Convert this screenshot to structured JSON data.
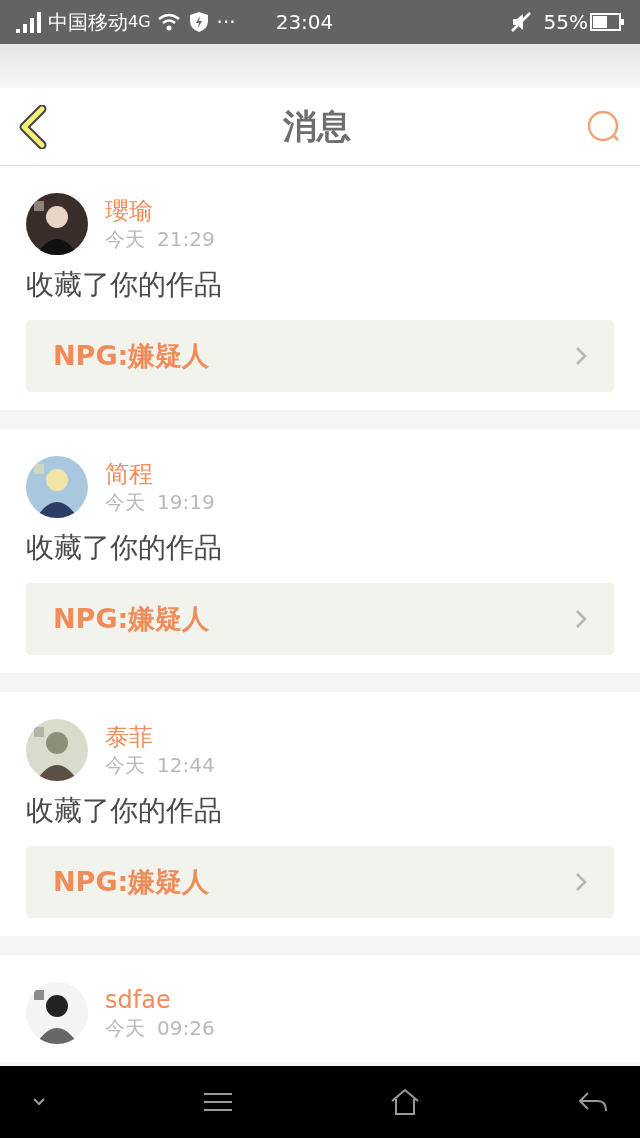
{
  "status_bar": {
    "carrier": "中国移动",
    "network": "4G",
    "dots": "···",
    "time": "23:04",
    "battery": "55%"
  },
  "header": {
    "title": "消息"
  },
  "messages": [
    {
      "user": "瓔瑜",
      "day": "今天",
      "time": "21:29",
      "action": "收藏了你的作品",
      "work": "NPG:嫌疑人"
    },
    {
      "user": "简程",
      "day": "今天",
      "time": "19:19",
      "action": "收藏了你的作品",
      "work": "NPG:嫌疑人"
    },
    {
      "user": "泰菲",
      "day": "今天",
      "time": "12:44",
      "action": "收藏了你的作品",
      "work": "NPG:嫌疑人"
    },
    {
      "user": "sdfae",
      "day": "今天",
      "time": "09:26"
    }
  ]
}
